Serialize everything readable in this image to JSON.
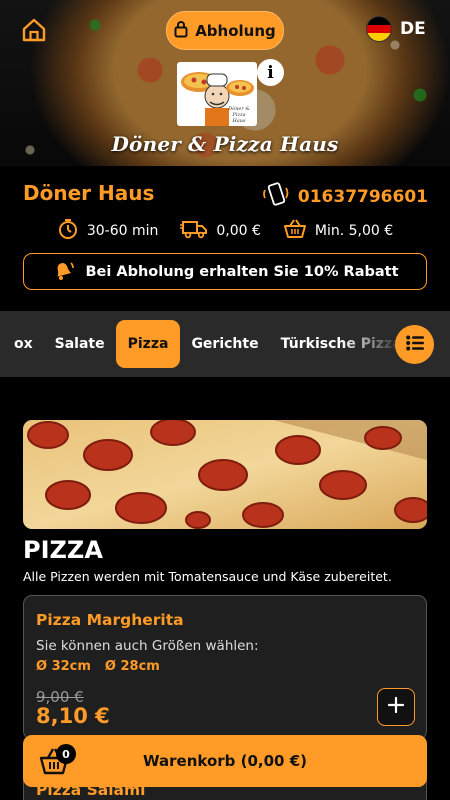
{
  "header": {
    "pickup_label": "Abholung",
    "language": "DE",
    "shop_title": "Döner & Pizza Haus",
    "logo_text_line1": "Döner & Pizza",
    "logo_text_line2": "Haus",
    "info_glyph": "i"
  },
  "shop": {
    "name": "Döner Haus",
    "phone": "01637796601",
    "delivery_time": "30-60 min",
    "delivery_fee": "0,00 €",
    "min_order": "Min. 5,00 €",
    "promo": "Bei Abholung erhalten Sie 10% Rabatt"
  },
  "categories": {
    "items": [
      "ox",
      "Salate",
      "Pizza",
      "Gerichte",
      "Türkische Pizza"
    ],
    "active": "Pizza"
  },
  "section": {
    "title": "PIZZA",
    "subtitle": "Alle Pizzen werden mit Tomatensauce und Käse zubereitet."
  },
  "products": [
    {
      "name": "Pizza Margherita",
      "sizes_label": "Sie können auch Größen wählen:",
      "sizes": [
        "Ø 32cm",
        "Ø 28cm"
      ],
      "old_price": "9,00 €",
      "new_price": "8,10 €"
    },
    {
      "name": "Pizza Salami"
    }
  ],
  "cart": {
    "label": "Warenkorb (0,00 €)",
    "count": "0"
  },
  "icons": [
    "home-icon",
    "lock-icon",
    "flag-de-icon",
    "info-icon",
    "phone-icon",
    "timer-icon",
    "delivery-truck-icon",
    "basket-icon",
    "bell-icon",
    "list-icon",
    "plus-icon",
    "cart-icon"
  ],
  "colors": {
    "accent": "#ff9b26",
    "background": "#000000",
    "category_bar": "#2a2a2a",
    "card": "#1f1f1f"
  }
}
